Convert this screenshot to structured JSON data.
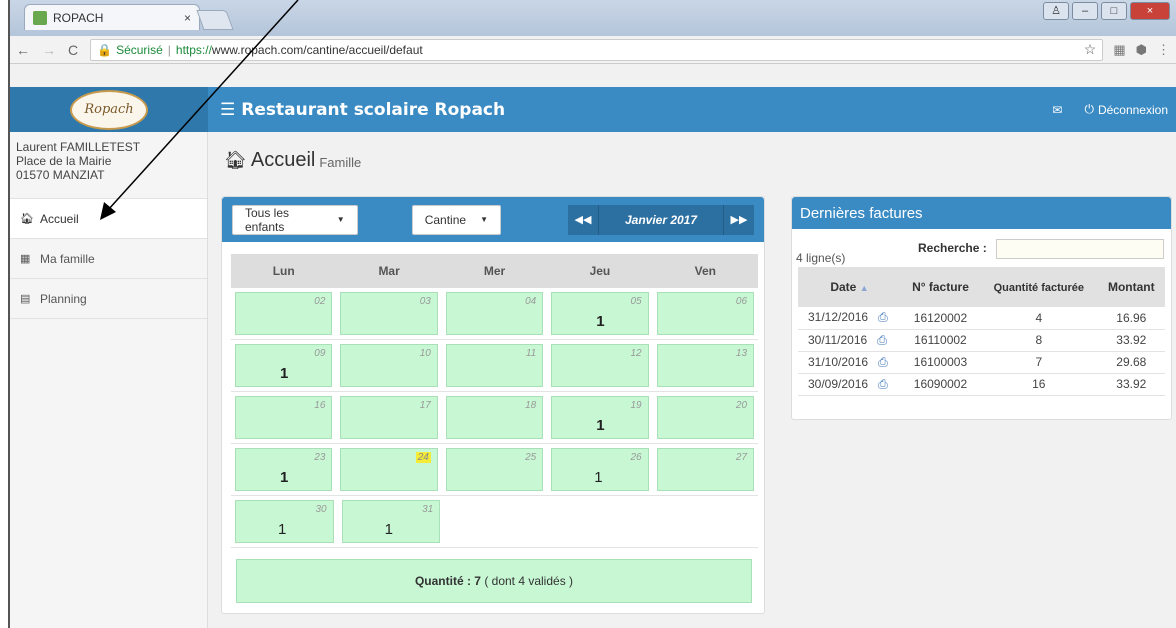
{
  "browser": {
    "tab_title": "ROPACH",
    "tab_close": "×",
    "secure_label": "Sécurisé",
    "url_proto": "https://",
    "url_rest": "www.ropach.com/cantine/accueil/defaut"
  },
  "app": {
    "logo_text": "Ropach",
    "title": "Restaurant scolaire Ropach",
    "logout": "Déconnexion"
  },
  "user": {
    "name": "Laurent FAMILLETEST",
    "address": "Place de la Mairie",
    "city": "01570 MANZIAT"
  },
  "sidebar": {
    "items": [
      {
        "label": "Accueil"
      },
      {
        "label": "Ma famille"
      },
      {
        "label": "Planning"
      }
    ]
  },
  "page": {
    "title": "Accueil",
    "subtitle": "Famille"
  },
  "calendar": {
    "children_select": "Tous les enfants",
    "service_select": "Cantine",
    "month": "Janvier 2017",
    "weekdays": [
      "Lun",
      "Mar",
      "Mer",
      "Jeu",
      "Ven"
    ],
    "days": {
      "d02": "02",
      "d03": "03",
      "d04": "04",
      "d05": "05",
      "d06": "06",
      "d09": "09",
      "d10": "10",
      "d11": "11",
      "d12": "12",
      "d13": "13",
      "d16": "16",
      "d17": "17",
      "d18": "18",
      "d19": "19",
      "d20": "20",
      "d23": "23",
      "d24": "24",
      "d25": "25",
      "d26": "26",
      "d27": "27",
      "d30": "30",
      "d31": "31"
    },
    "quantities": {
      "d05": "1",
      "d09": "1",
      "d19": "1",
      "d23": "1",
      "d26": "1",
      "d30": "1",
      "d31": "1"
    },
    "summary_label": "Quantité : 7",
    "summary_detail": "( dont 4 validés )"
  },
  "invoices": {
    "title": "Dernières factures",
    "count": "4 ligne(s)",
    "search_label": "Recherche :",
    "search_value": "",
    "headers": {
      "date": "Date",
      "number": "N° facture",
      "qty": "Quantité facturée",
      "amount": "Montant"
    },
    "rows": [
      {
        "date": "31/12/2016",
        "number": "16120002",
        "qty": "4",
        "amount": "16.96"
      },
      {
        "date": "30/11/2016",
        "number": "16110002",
        "qty": "8",
        "amount": "33.92"
      },
      {
        "date": "31/10/2016",
        "number": "16100003",
        "qty": "7",
        "amount": "29.68"
      },
      {
        "date": "30/09/2016",
        "number": "16090002",
        "qty": "16",
        "amount": "33.92"
      }
    ]
  },
  "colors": {
    "header": "#3a8bc4",
    "day_fill": "#c8f7d4",
    "highlight": "#f5ec38"
  }
}
